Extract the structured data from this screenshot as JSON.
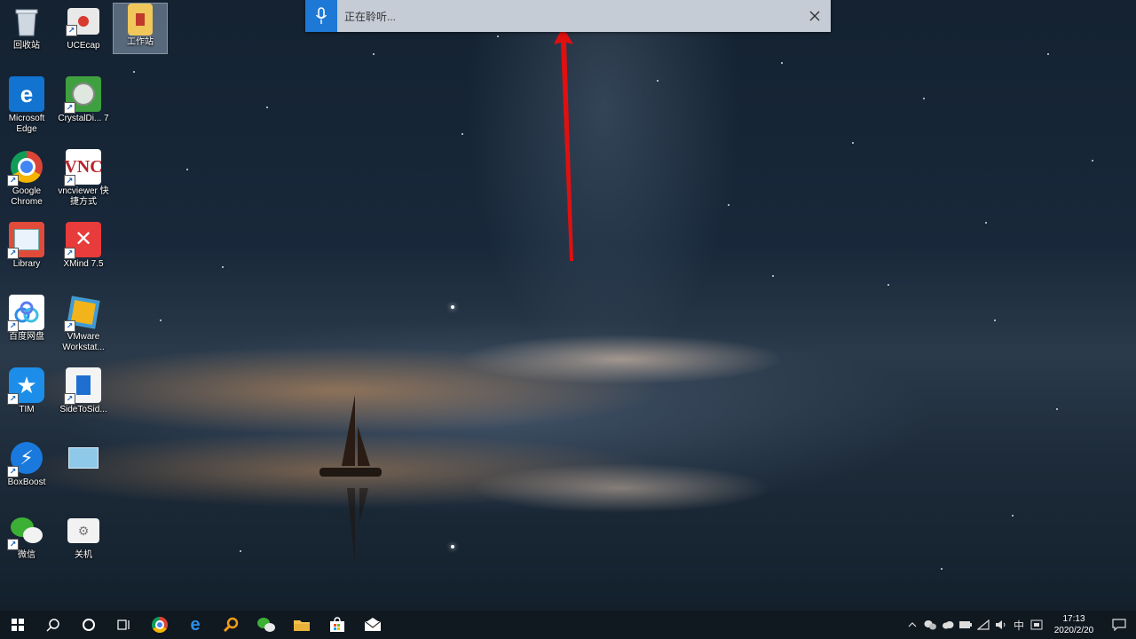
{
  "dictation": {
    "status": "正在聆听...",
    "accent": "#1e79d6"
  },
  "desktop_icons": [
    {
      "label": "回收站",
      "icon": "recycle-bin-icon"
    },
    {
      "label": "UCEcap",
      "icon": "uccap-icon"
    },
    {
      "label": "工作站",
      "icon": "workstation-folder-icon"
    },
    {
      "label": "Microsoft Edge",
      "icon": "edge-icon"
    },
    {
      "label": "CrystalDi... 7",
      "icon": "crystaldisk-icon"
    },
    {
      "label": "Google Chrome",
      "icon": "chrome-icon"
    },
    {
      "label": "vncviewer 快捷方式",
      "icon": "vnc-icon"
    },
    {
      "label": "Library",
      "icon": "library-icon"
    },
    {
      "label": "XMind 7.5",
      "icon": "xmind-icon"
    },
    {
      "label": "百度网盘",
      "icon": "baidu-netdisk-icon"
    },
    {
      "label": "VMware Workstat...",
      "icon": "vmware-icon"
    },
    {
      "label": "TIM",
      "icon": "tim-icon"
    },
    {
      "label": "SideToSid...",
      "icon": "sidetoside-icon"
    },
    {
      "label": "BoxBoost",
      "icon": "boxboost-icon"
    },
    {
      "label": "",
      "icon": "remote-display-icon"
    },
    {
      "label": "微信",
      "icon": "wechat-icon"
    },
    {
      "label": "关机",
      "icon": "shutdown-icon"
    }
  ],
  "taskbar": {
    "pinned": [
      "windows-start-icon",
      "search-icon",
      "cortana-icon",
      "task-view-icon",
      "chrome-icon",
      "edge-icon",
      "magnifier-app-icon",
      "wechat-icon",
      "file-explorer-icon",
      "store-icon",
      "mail-icon"
    ],
    "tray": {
      "ime": "中",
      "time": "17:13",
      "date": "2020/2/20"
    }
  }
}
